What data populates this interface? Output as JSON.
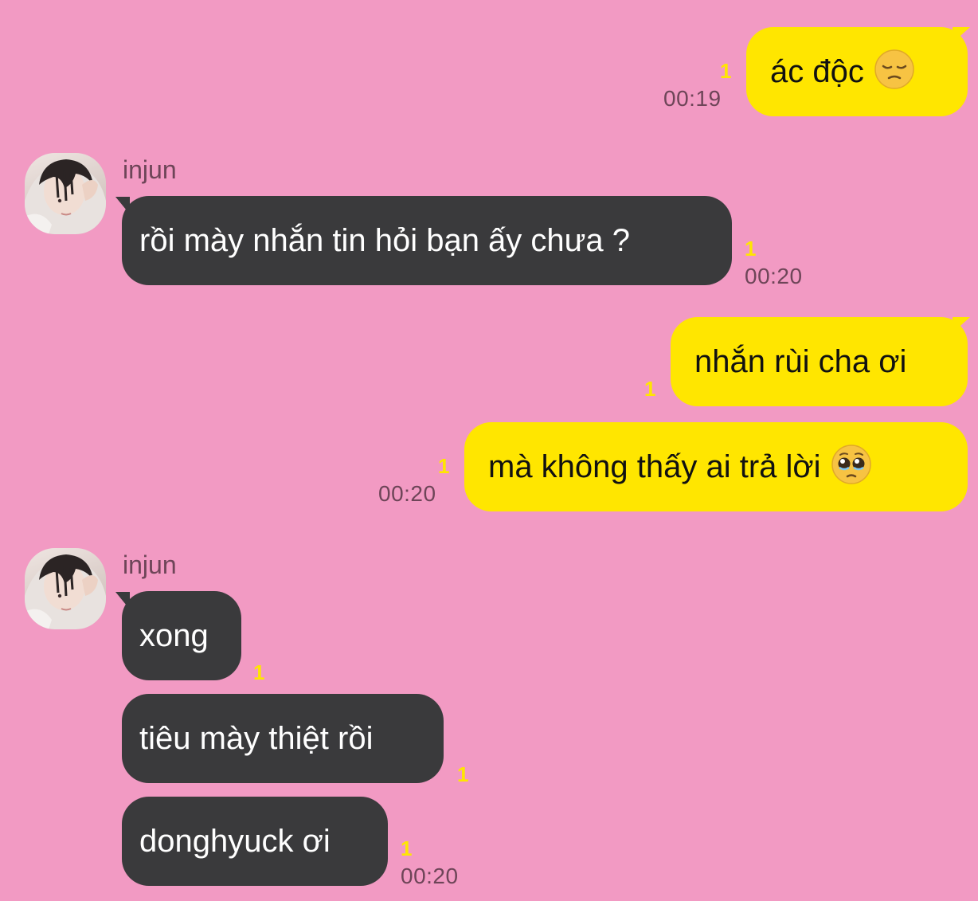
{
  "messages": [
    {
      "side": "out",
      "text": "ác độc",
      "emoji": "pensive-face-emoji",
      "read": "1",
      "time": "00:19"
    },
    {
      "side": "in",
      "sender": "injun",
      "text": "rồi mày nhắn tin hỏi bạn ấy chưa ?",
      "read": "1",
      "time": "00:20"
    },
    {
      "side": "out",
      "text": "nhắn rùi cha ơi",
      "read": "1"
    },
    {
      "side": "out",
      "text": "mà không thấy ai trả lời",
      "emoji": "pleading-face-emoji",
      "read": "1",
      "time": "00:20"
    },
    {
      "side": "in",
      "sender": "injun",
      "text": "xong",
      "read": "1"
    },
    {
      "side": "in",
      "text": "tiêu mày thiệt rồi",
      "read": "1"
    },
    {
      "side": "in",
      "text": "donghyuck ơi",
      "read": "1",
      "time": "00:20"
    }
  ],
  "colors": {
    "background": "#f29ac3",
    "outgoing_bubble": "#ffe600",
    "incoming_bubble": "#3a3a3c",
    "read_count": "#ffe600",
    "meta_text": "#6e4558"
  }
}
